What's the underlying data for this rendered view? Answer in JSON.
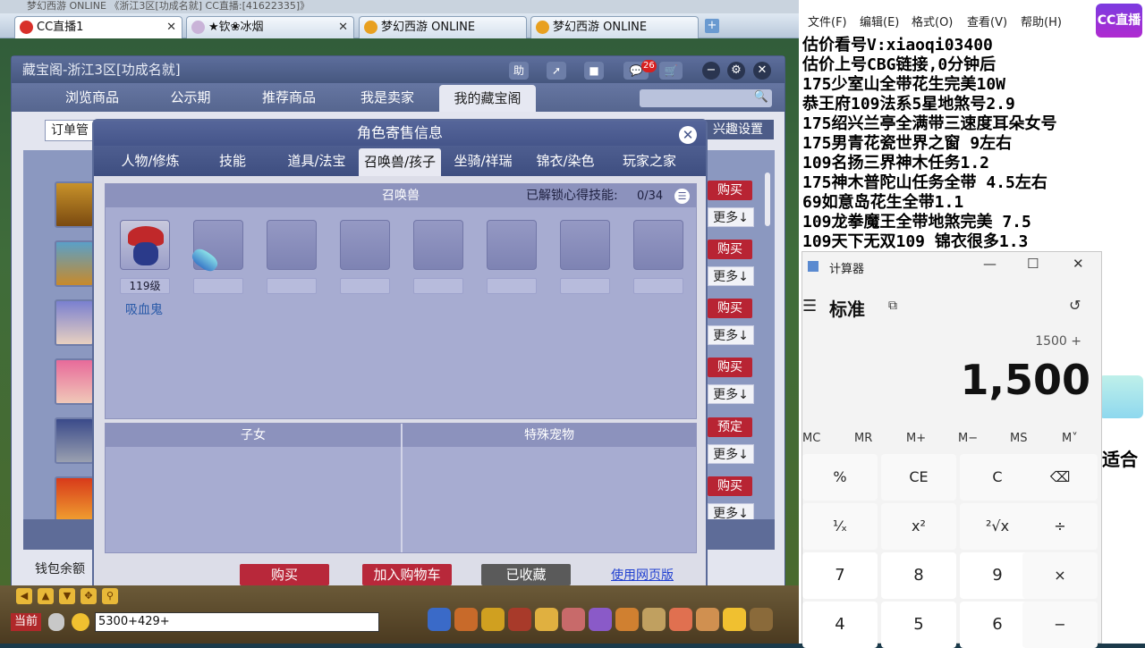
{
  "browser": {
    "top_strip": "梦幻西游 ONLINE   《浙江3区[功成名就]    CC直播:[41622335]》",
    "tabs": [
      {
        "label": "CC直播1"
      },
      {
        "label": "★钦❀冰烟"
      },
      {
        "label": "梦幻西游 ONLINE"
      },
      {
        "label": "梦幻西游 ONLINE"
      }
    ]
  },
  "cbg": {
    "title": "藏宝阁-浙江3区[功成名就]",
    "help_label": "助",
    "cart_badge": "26",
    "nav": [
      "浏览商品",
      "公示期",
      "推荐商品",
      "我是卖家",
      "我的藏宝阁"
    ],
    "order_mgr": "订单管",
    "interest_settings": "兴趣设置",
    "rows": [
      {
        "btn": "购买",
        "more": "更多↓"
      },
      {
        "btn": "购买",
        "more": "更多↓"
      },
      {
        "btn": "购买",
        "more": "更多↓"
      },
      {
        "btn": "购买",
        "more": "更多↓"
      },
      {
        "btn": "预定",
        "more": "更多↓"
      },
      {
        "btn": "购买",
        "more": "更多↓"
      }
    ],
    "wallet": "钱包余额"
  },
  "modal": {
    "title": "角色寄售信息",
    "tabs": [
      "人物/修炼",
      "技能",
      "道具/法宝",
      "召唤兽/孩子",
      "坐骑/祥瑞",
      "锦衣/染色",
      "玩家之家"
    ],
    "pet_section_title": "召唤兽",
    "unlock_label": "已解锁心得技能:",
    "unlock_value": "0/34",
    "pet_level": "119级",
    "pet_name": "吸血鬼",
    "children_title": "子女",
    "special_pets_title": "特殊宠物",
    "buttons": {
      "buy": "购买",
      "add_cart": "加入购物车",
      "favorited": "已收藏"
    },
    "web_link": "使用网页版"
  },
  "game_bar": {
    "channel": "当前",
    "chat_input": "5300+429+"
  },
  "notepad": {
    "menu": [
      "文件(F)",
      "编辑(E)",
      "格式(O)",
      "查看(V)",
      "帮助(H)"
    ],
    "lines": [
      "估价看号V:xiaoqi03400",
      "估价上号CBG链接,0分钟后",
      "175少室山全带花生完美10W",
      "恭王府109法系5星地煞号2.9",
      "175绍兴兰亭全满带三速度耳朵女号",
      "175男青花瓷世界之窗  9左右",
      "109名扬三界神木任务1.2",
      "175神木普陀山任务全带 4.5左右",
      "69如意岛花生全带1.1",
      "109龙拳魔王全带地煞完美 7.5",
      "109天下无双109  锦衣很多1.3"
    ],
    "right_fragment": "适合"
  },
  "cc_badge": "CC直播",
  "calculator": {
    "title": "计算器",
    "mode": "标准",
    "expression": "1500 +",
    "result": "1,500",
    "memory": [
      "MC",
      "MR",
      "M+",
      "M−",
      "MS",
      "M˅"
    ],
    "keys": [
      [
        "%",
        "CE",
        "C",
        "⌫"
      ],
      [
        "¹⁄ₓ",
        "x²",
        "²√x",
        "÷"
      ],
      [
        "7",
        "8",
        "9",
        "×"
      ],
      [
        "4",
        "5",
        "6",
        "−"
      ]
    ]
  }
}
